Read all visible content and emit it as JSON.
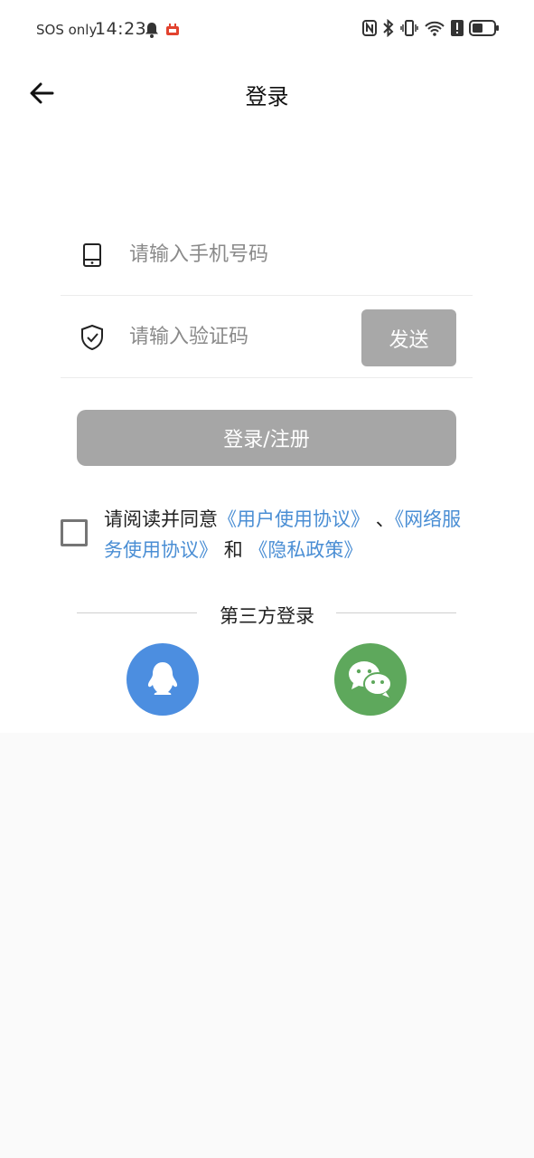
{
  "status_bar": {
    "carrier": "SOS only",
    "time": "14:23"
  },
  "header": {
    "title": "登录"
  },
  "phone_input": {
    "placeholder": "请输入手机号码"
  },
  "code_input": {
    "placeholder": "请输入验证码",
    "send_label": "发送"
  },
  "login_button": {
    "label": "登录/注册"
  },
  "agreement": {
    "prefix": "请阅读并同意",
    "link_user": "《用户使用协议》",
    "separator": "、",
    "link_network": "《网络服务使用协议》",
    "conjunction": "和",
    "link_privacy": "《隐私政策》"
  },
  "third_party": {
    "label": "第三方登录"
  },
  "colors": {
    "accent_link": "#4a8ed4",
    "qq": "#4c8ee0",
    "wechat": "#5ea85c",
    "disabled_button": "#a6a6a6"
  }
}
